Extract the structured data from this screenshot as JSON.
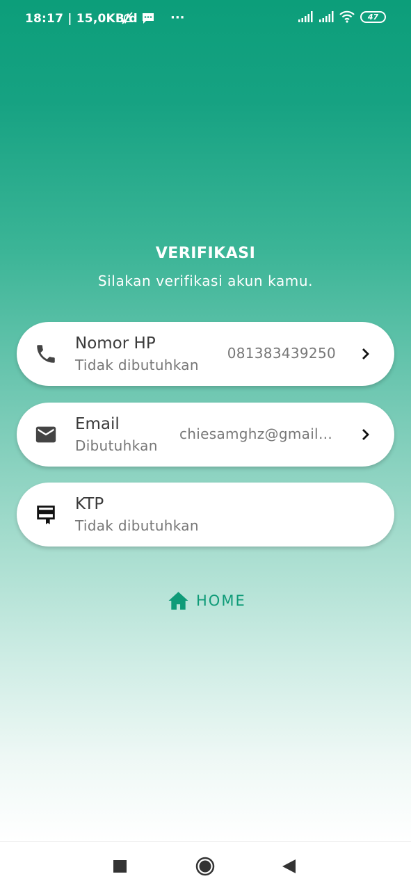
{
  "status_bar": {
    "time_speed": "18:17 | 15,0KB/d",
    "more": "···",
    "battery": "47"
  },
  "header": {
    "title": "VERIFIKASI",
    "subtitle": "Silakan verifikasi akun kamu."
  },
  "items": [
    {
      "title": "Nomor HP",
      "status": "Tidak dibutuhkan",
      "value": "081383439250",
      "icon": "phone-icon"
    },
    {
      "title": "Email",
      "status": "Dibutuhkan",
      "value": "chiesamghz@gmail.com",
      "icon": "email-icon"
    },
    {
      "title": "KTP",
      "status": "Tidak dibutuhkan",
      "value": "",
      "icon": "id-card-icon"
    }
  ],
  "home_button": {
    "label": "HOME",
    "icon": "home-icon"
  },
  "colors": {
    "accent": "#0f9b78",
    "gradient_top": "#0c9e7a",
    "gradient_bottom": "#ffffff"
  }
}
